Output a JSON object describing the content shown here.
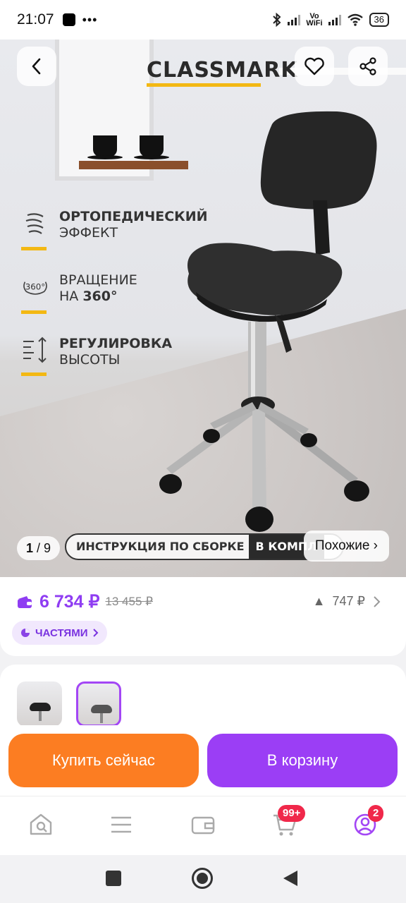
{
  "status_bar": {
    "time": "21:07",
    "dots": "•••",
    "vowifi_top": "Vo",
    "vowifi_bottom": "WiFi",
    "battery": "36"
  },
  "hero": {
    "brand": "CLASSMARK",
    "features": [
      {
        "icon": "orthopedic-icon",
        "line1": "ОРТОПЕДИЧЕСКИЙ",
        "line2": "ЭФФЕКТ"
      },
      {
        "icon": "rotation-360-icon",
        "icon_text": "360°",
        "line1": "ВРАЩЕНИЕ",
        "line2_prefix": "НА ",
        "line2_bold": "360°"
      },
      {
        "icon": "height-adjust-icon",
        "line1": "РЕГУЛИРОВКА",
        "line2": "ВЫСОТЫ"
      }
    ],
    "counter_current": "1",
    "counter_total": "/ 9",
    "assembly_text": "ИНСТРУКЦИЯ ПО СБОРКЕ",
    "assembly_dark": "В КОМПЛ",
    "similar_label": "Похожие ›"
  },
  "price": {
    "current": "6 734 ₽",
    "old": "13 455 ₽",
    "bonus": "747 ₽",
    "parts_label": "ЧАСТЯМИ"
  },
  "thumbnails": {
    "count": 2,
    "active_index": 1
  },
  "actions": {
    "buy_now": "Купить сейчас",
    "add_to_cart": "В корзину"
  },
  "bottom_nav": {
    "items": [
      "home-icon",
      "catalog-icon",
      "wallet-icon",
      "cart-icon",
      "profile-icon"
    ],
    "cart_badge": "99+",
    "profile_badge": "2"
  },
  "colors": {
    "accent_purple": "#9b3ef5",
    "accent_orange": "#fc7d22",
    "brand_yellow": "#f3b813",
    "price_purple": "#8f3df2",
    "badge_red": "#f0284a"
  }
}
